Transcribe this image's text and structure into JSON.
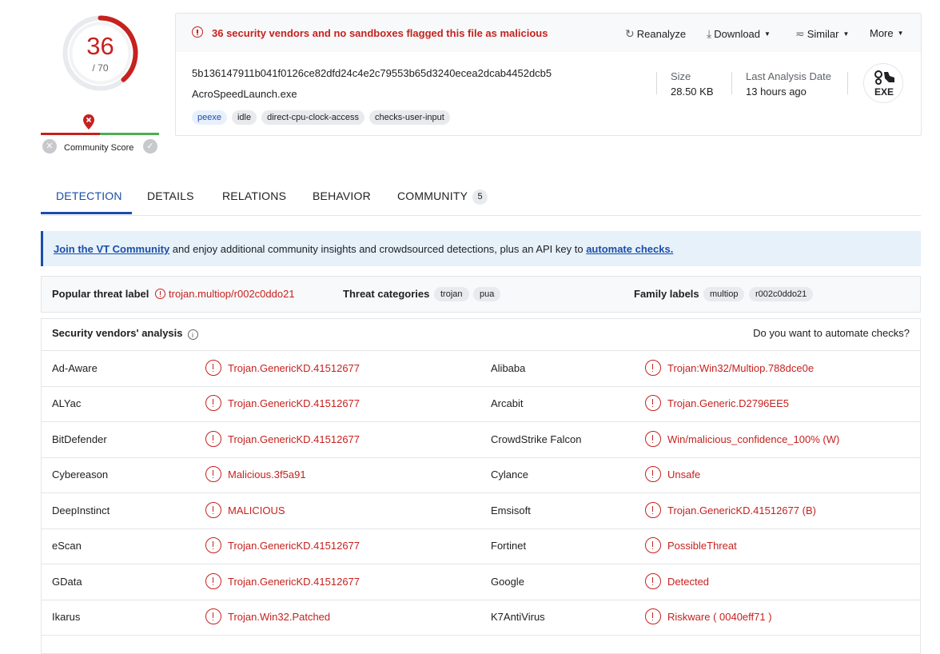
{
  "score": {
    "detections": "36",
    "total": "/ 70"
  },
  "community": {
    "label": "Community Score"
  },
  "alert": {
    "text": "36 security vendors and no sandboxes flagged this file as malicious"
  },
  "actions": [
    {
      "label": "Reanalyze",
      "icon": "refresh-icon"
    },
    {
      "label": "Download",
      "icon": "download-icon"
    },
    {
      "label": "Similar",
      "icon": "similar-icon"
    },
    {
      "label": "More",
      "icon": ""
    }
  ],
  "file": {
    "hash": "5b136147911b041f0126ce82dfd24c4e2c79553b65d3240ecea2dcab4452dcb5",
    "name": "AcroSpeedLaunch.exe",
    "tags": [
      "peexe",
      "idle",
      "direct-cpu-clock-access",
      "checks-user-input"
    ],
    "size_label": "Size",
    "size": "28.50 KB",
    "date_label": "Last Analysis Date",
    "date": "13 hours ago",
    "type_badge": "EXE"
  },
  "tabs": [
    {
      "label": "DETECTION",
      "active": true
    },
    {
      "label": "DETAILS"
    },
    {
      "label": "RELATIONS"
    },
    {
      "label": "BEHAVIOR"
    },
    {
      "label": "COMMUNITY",
      "badge": "5"
    }
  ],
  "banner": {
    "link1": "Join the VT Community",
    "middle": " and enjoy additional community insights and crowdsourced detections, plus an API key to ",
    "link2": "automate checks."
  },
  "threat": {
    "popular_label": "Popular threat label",
    "popular_value": "trojan.multiop/r002c0ddo21",
    "categories_label": "Threat categories",
    "categories": [
      "trojan",
      "pua"
    ],
    "family_label": "Family labels",
    "families": [
      "multiop",
      "r002c0ddo21"
    ]
  },
  "vendors_section": {
    "title": "Security vendors' analysis",
    "automate": "Do you want to automate checks?"
  },
  "vendor_rows": [
    {
      "left": {
        "vendor": "Ad-Aware",
        "result": "Trojan.GenericKD.41512677"
      },
      "right": {
        "vendor": "Alibaba",
        "result": "Trojan:Win32/Multiop.788dce0e"
      }
    },
    {
      "left": {
        "vendor": "ALYac",
        "result": "Trojan.GenericKD.41512677"
      },
      "right": {
        "vendor": "Arcabit",
        "result": "Trojan.Generic.D2796EE5"
      }
    },
    {
      "left": {
        "vendor": "BitDefender",
        "result": "Trojan.GenericKD.41512677"
      },
      "right": {
        "vendor": "CrowdStrike Falcon",
        "result": "Win/malicious_confidence_100% (W)"
      }
    },
    {
      "left": {
        "vendor": "Cybereason",
        "result": "Malicious.3f5a91"
      },
      "right": {
        "vendor": "Cylance",
        "result": "Unsafe"
      }
    },
    {
      "left": {
        "vendor": "DeepInstinct",
        "result": "MALICIOUS"
      },
      "right": {
        "vendor": "Emsisoft",
        "result": "Trojan.GenericKD.41512677 (B)"
      }
    },
    {
      "left": {
        "vendor": "eScan",
        "result": "Trojan.GenericKD.41512677"
      },
      "right": {
        "vendor": "Fortinet",
        "result": "PossibleThreat"
      }
    },
    {
      "left": {
        "vendor": "GData",
        "result": "Trojan.GenericKD.41512677"
      },
      "right": {
        "vendor": "Google",
        "result": "Detected"
      }
    },
    {
      "left": {
        "vendor": "Ikarus",
        "result": "Trojan.Win32.Patched"
      },
      "right": {
        "vendor": "K7AntiVirus",
        "result": "Riskware ( 0040eff71 )"
      }
    }
  ],
  "colors": {
    "malicious": "#c5221f",
    "accent": "#1a4ea8",
    "harmless": "#4caf50"
  }
}
